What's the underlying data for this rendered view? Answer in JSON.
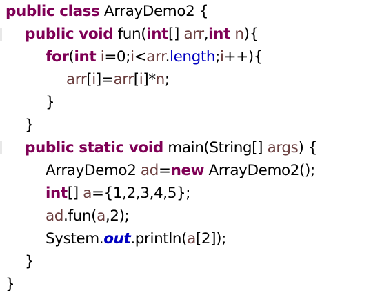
{
  "code_lines": [
    [
      {
        "t": "public class",
        "k": "kw"
      },
      {
        "t": " ArrayDemo2 {",
        "k": "plain"
      }
    ],
    [
      {
        "t": "public void",
        "k": "kw"
      },
      {
        "t": " fun(",
        "k": "plain"
      },
      {
        "t": "int",
        "k": "kw"
      },
      {
        "t": "[] ",
        "k": "plain"
      },
      {
        "t": "arr",
        "k": "var"
      },
      {
        "t": ",",
        "k": "plain"
      },
      {
        "t": "int",
        "k": "kw"
      },
      {
        "t": " ",
        "k": "plain"
      },
      {
        "t": "n",
        "k": "var"
      },
      {
        "t": "){",
        "k": "plain"
      }
    ],
    [
      {
        "t": "for",
        "k": "kw"
      },
      {
        "t": "(",
        "k": "plain"
      },
      {
        "t": "int",
        "k": "kw"
      },
      {
        "t": " ",
        "k": "plain"
      },
      {
        "t": "i",
        "k": "var"
      },
      {
        "t": "=0;",
        "k": "plain"
      },
      {
        "t": "i",
        "k": "var"
      },
      {
        "t": "<",
        "k": "plain"
      },
      {
        "t": "arr",
        "k": "var"
      },
      {
        "t": ".",
        "k": "plain"
      },
      {
        "t": "length",
        "k": "fld"
      },
      {
        "t": ";",
        "k": "plain"
      },
      {
        "t": "i",
        "k": "var"
      },
      {
        "t": "++){",
        "k": "plain"
      }
    ],
    [
      {
        "t": "arr",
        "k": "var"
      },
      {
        "t": "[",
        "k": "plain"
      },
      {
        "t": "i",
        "k": "var"
      },
      {
        "t": "]=",
        "k": "plain"
      },
      {
        "t": "arr",
        "k": "var"
      },
      {
        "t": "[",
        "k": "plain"
      },
      {
        "t": "i",
        "k": "var"
      },
      {
        "t": "]*",
        "k": "plain"
      },
      {
        "t": "n",
        "k": "var"
      },
      {
        "t": ";",
        "k": "plain"
      }
    ],
    [
      {
        "t": "}",
        "k": "plain"
      }
    ],
    [
      {
        "t": "}",
        "k": "plain"
      }
    ],
    [
      {
        "t": "public static void",
        "k": "kw"
      },
      {
        "t": " main(String[] ",
        "k": "plain"
      },
      {
        "t": "args",
        "k": "var"
      },
      {
        "t": ") {",
        "k": "plain"
      }
    ],
    [
      {
        "t": "ArrayDemo2 ",
        "k": "plain"
      },
      {
        "t": "ad",
        "k": "var"
      },
      {
        "t": "=",
        "k": "plain"
      },
      {
        "t": "new",
        "k": "kw"
      },
      {
        "t": " ArrayDemo2();",
        "k": "plain"
      }
    ],
    [
      {
        "t": "int",
        "k": "kw"
      },
      {
        "t": "[] ",
        "k": "plain"
      },
      {
        "t": "a",
        "k": "var"
      },
      {
        "t": "={1,2,3,4,5};",
        "k": "plain"
      }
    ],
    [
      {
        "t": "ad",
        "k": "var"
      },
      {
        "t": ".fun(",
        "k": "plain"
      },
      {
        "t": "a",
        "k": "var"
      },
      {
        "t": ",2);",
        "k": "plain"
      }
    ],
    [
      {
        "t": "System.",
        "k": "plain"
      },
      {
        "t": "out",
        "k": "sfld"
      },
      {
        "t": ".println(",
        "k": "plain"
      },
      {
        "t": "a",
        "k": "var"
      },
      {
        "t": "[2]);",
        "k": "plain"
      }
    ],
    [
      {
        "t": "}",
        "k": "plain"
      }
    ],
    [
      {
        "t": "}",
        "k": "plain"
      }
    ]
  ],
  "colors": {
    "keyword": "#7f0055",
    "variable": "#6a3e3e",
    "field": "#0000c0",
    "text": "#000000",
    "background": "#ffffff"
  }
}
